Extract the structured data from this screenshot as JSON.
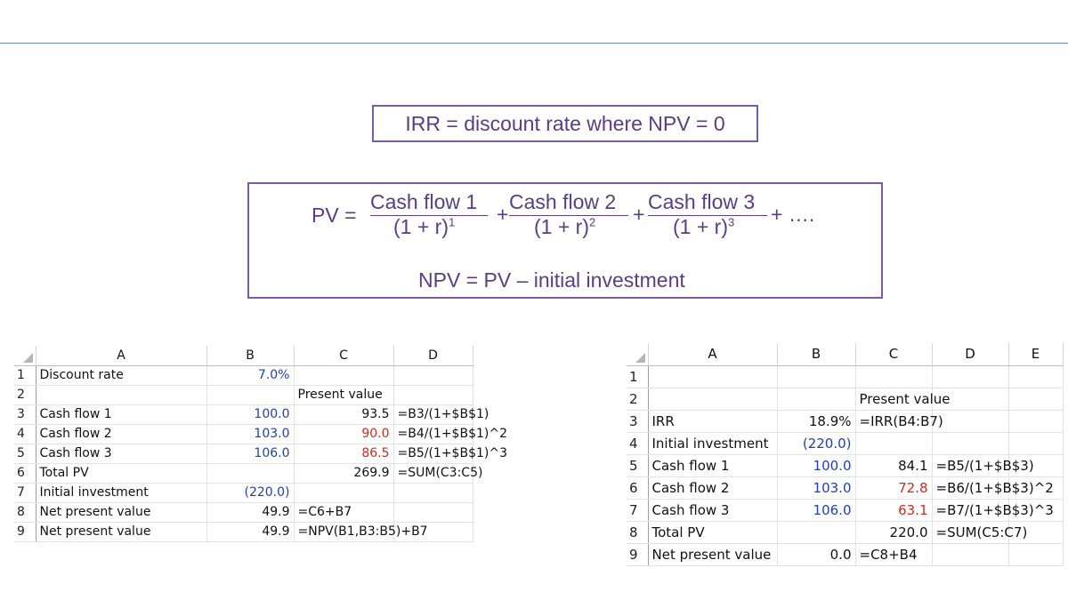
{
  "irr_definition": "IRR = discount rate where NPV = 0",
  "formula": {
    "pv_label": "PV =",
    "terms": [
      {
        "num": "Cash flow 1",
        "den": "(1 + r)",
        "exp": "1"
      },
      {
        "num": "Cash flow 2",
        "den": "(1 + r)",
        "exp": "2"
      },
      {
        "num": "Cash flow 3",
        "den": "(1 + r)",
        "exp": "3"
      }
    ],
    "plus": "+",
    "tail": "+ ….",
    "npv_line": "NPV = PV – initial investment"
  },
  "sheet1": {
    "columns": [
      "A",
      "B",
      "C",
      "D"
    ],
    "rows": [
      {
        "n": "1",
        "a": "Discount rate",
        "b": "7.0%",
        "c": "",
        "d": ""
      },
      {
        "n": "2",
        "a": "",
        "b": "",
        "c": "Present value",
        "d": ""
      },
      {
        "n": "3",
        "a": "Cash flow 1",
        "b": "100.0",
        "c": "93.5",
        "d": "=B3/(1+$B$1)"
      },
      {
        "n": "4",
        "a": "Cash flow 2",
        "b": "103.0",
        "c": "90.0",
        "d": "=B4/(1+$B$1)^2"
      },
      {
        "n": "5",
        "a": "Cash flow 3",
        "b": "106.0",
        "c": "86.5",
        "d": "=B5/(1+$B$1)^3"
      },
      {
        "n": "6",
        "a": "Total PV",
        "b": "",
        "c": "269.9",
        "d": "=SUM(C3:C5)"
      },
      {
        "n": "7",
        "a": "Initial investment",
        "b": "(220.0)",
        "c": "",
        "d": ""
      },
      {
        "n": "8",
        "a": "Net present value",
        "b": "49.9",
        "c": "=C6+B7",
        "d": ""
      },
      {
        "n": "9",
        "a": "Net present value",
        "b": "49.9",
        "c": "=NPV(B1,B3:B5)+B7",
        "d": ""
      }
    ]
  },
  "sheet2": {
    "columns": [
      "A",
      "B",
      "C",
      "D",
      "E"
    ],
    "rows": [
      {
        "n": "1",
        "a": "",
        "b": "",
        "c": "",
        "d": ""
      },
      {
        "n": "2",
        "a": "",
        "b": "",
        "c": "Present value",
        "d": ""
      },
      {
        "n": "3",
        "a": "IRR",
        "b": "18.9%",
        "c": "=IRR(B4:B7)",
        "d": ""
      },
      {
        "n": "4",
        "a": "Initial investment",
        "b": "(220.0)",
        "c": "",
        "d": ""
      },
      {
        "n": "5",
        "a": "Cash flow 1",
        "b": "100.0",
        "c": "84.1",
        "d": "=B5/(1+$B$3)"
      },
      {
        "n": "6",
        "a": "Cash flow 2",
        "b": "103.0",
        "c": "72.8",
        "d": "=B6/(1+$B$3)^2"
      },
      {
        "n": "7",
        "a": "Cash flow 3",
        "b": "106.0",
        "c": "63.1",
        "d": "=B7/(1+$B$3)^3"
      },
      {
        "n": "8",
        "a": "Total PV",
        "b": "",
        "c": "220.0",
        "d": "=SUM(C5:C7)"
      },
      {
        "n": "9",
        "a": "Net present value",
        "b": "0.0",
        "c": "=C8+B4",
        "d": ""
      }
    ]
  },
  "colors": {
    "accent": "#5a3d86",
    "input_blue": "#1f3fb5",
    "calc_red": "#d12a1c"
  }
}
